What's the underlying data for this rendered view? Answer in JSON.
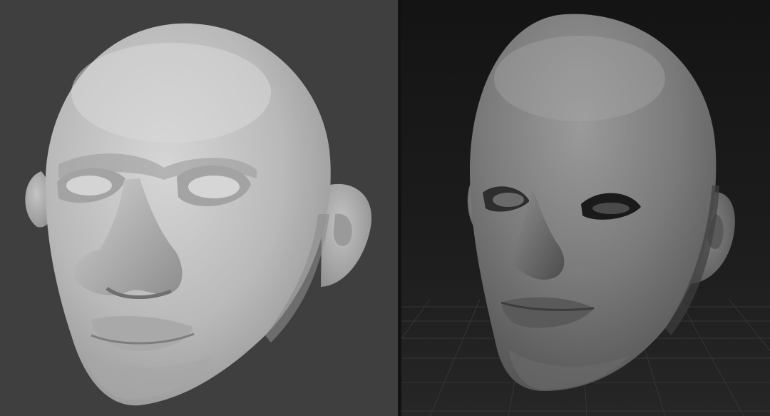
{
  "views": {
    "left": {
      "subject": "lowpoly-head-sculpt",
      "background_color": "#3f3f3f",
      "surface_color": "#bfbfbf"
    },
    "right": {
      "subject": "smooth-head-sculpt",
      "background_color": "#1a1a1a",
      "surface_color": "#7c7c7c",
      "floor_grid": true
    }
  },
  "divider_color": "#121212"
}
